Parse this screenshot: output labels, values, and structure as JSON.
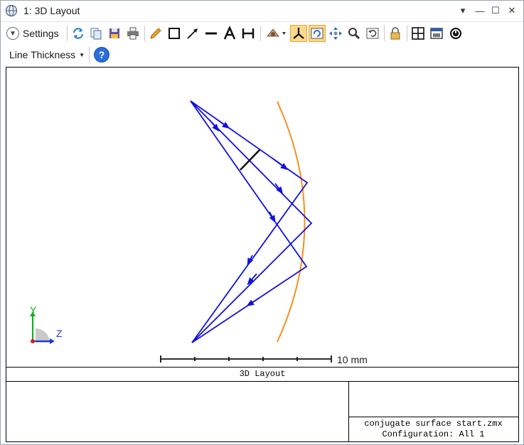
{
  "window": {
    "title": "1: 3D Layout",
    "controls": {
      "menu": "▾",
      "minimize": "—",
      "maximize": "☐",
      "close": "✕"
    }
  },
  "toolbar": {
    "settings_label": "Settings",
    "tools": [
      "refresh-icon",
      "copy-icon",
      "save-icon",
      "print-icon",
      "pencil-icon",
      "rectangle-icon",
      "arrow-line-icon",
      "line-icon",
      "text-icon",
      "dimension-icon",
      "rotate-view-icon",
      "axes-icon",
      "rotate-icon",
      "pan-icon",
      "zoom-icon",
      "reset-view-icon",
      "lock-icon",
      "layout-grid-icon",
      "window-icon",
      "clock-icon"
    ],
    "active_tools": [
      "axes-icon",
      "rotate-icon"
    ]
  },
  "toolbar2": {
    "line_thickness_label": "Line Thickness",
    "help_label": "?"
  },
  "plot": {
    "axis_y_label": "Y",
    "axis_z_label": "Z",
    "scale_label": "10 mm",
    "ray_color": "#1010e0",
    "mirror_color": "#f5901e"
  },
  "footer": {
    "title": "3D Layout",
    "file": "conjugate surface start.zmx",
    "configuration": "Configuration: All 1"
  }
}
